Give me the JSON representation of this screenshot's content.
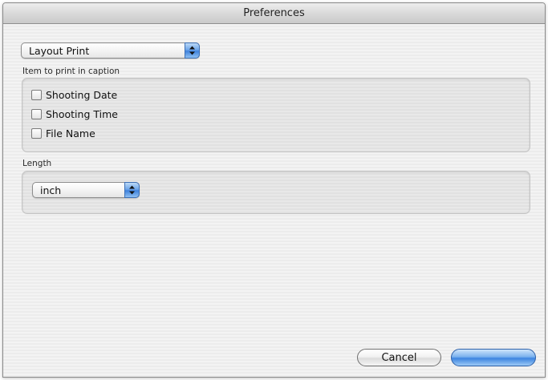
{
  "window": {
    "title": "Preferences"
  },
  "category_popup": {
    "value": "Layout Print"
  },
  "caption_group": {
    "label": "Item to print in caption",
    "items": [
      {
        "label": "Shooting Date",
        "checked": false
      },
      {
        "label": "Shooting Time",
        "checked": false
      },
      {
        "label": "File Name",
        "checked": false
      }
    ]
  },
  "length_group": {
    "label": "Length",
    "unit_value": "inch"
  },
  "footer": {
    "cancel_label": "Cancel",
    "default_label": ""
  }
}
